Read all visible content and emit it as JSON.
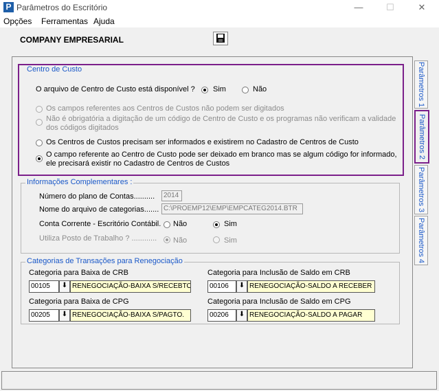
{
  "window": {
    "title": "Parâmetros do Escritório",
    "minimize": "—",
    "maximize": "☐",
    "close": "✕"
  },
  "menu": [
    "Opções",
    "Ferramentas",
    "Ajuda"
  ],
  "header": {
    "company": "COMPANY EMPRESARIAL"
  },
  "tabs": [
    "Parâmetros 1",
    "Parâmetros 2",
    "Parâmetros 3",
    "Parâmetros 4"
  ],
  "centro_custo": {
    "title": "Centro de Custo",
    "question": "O arquivo de  Centro de Custo  está disponível ?",
    "sim": "Sim",
    "nao": "Não",
    "options": [
      "Os campos referentes aos Centros de Custos não podem ser digitados",
      "Não é obrigatória a digitação de um código de Centro de Custo e os programas não verificam a validade",
      "dos códigos digitados",
      "Os Centros de Custos precisam ser informados e existirem no Cadastro de Centros de Custo",
      "O campo referente ao Centro de Custo pode ser deixado em branco mas se algum código for informado,",
      "ele precisará existir no Cadastro de Centros de Custos"
    ]
  },
  "info": {
    "title": "Informações Complementares :",
    "plano_label": "Número do plano de Contas..........",
    "plano_value": "2014",
    "arquivo_label": "Nome do arquivo de categorias.......",
    "arquivo_value": "C:\\PROEMP12\\EMP\\EMPCATEG2014.BTR",
    "conta_label": "Conta Corrente - Escritório Contábil.",
    "conta_nao": "Não",
    "conta_sim": "Sim",
    "posto_label": "Utiliza Posto de Trabalho ? ............",
    "posto_nao": "Não",
    "posto_sim": "Sim"
  },
  "categorias": {
    "title": "Categorias de Transações para Renegociação",
    "baixa_crb": {
      "label": "Categoria para Baixa de CRB",
      "code": "00105",
      "name": "RENEGOCIAÇÃO-BAIXA S/RECEBTO."
    },
    "incl_crb": {
      "label": "Categoria para Inclusão de Saldo em CRB",
      "code": "00106",
      "name": "RENEGOCIAÇÃO-SALDO A RECEBER"
    },
    "baixa_cpg": {
      "label": "Categoria para Baixa de CPG",
      "code": "00205",
      "name": "RENEGOCIAÇÃO-BAIXA S/PAGTO."
    },
    "incl_cpg": {
      "label": "Categoria para Inclusão de Saldo em CPG",
      "code": "00206",
      "name": "RENEGOCIAÇÃO-SALDO A PAGAR"
    },
    "dropdown_glyph": "⬇"
  },
  "colors": {
    "accent": "#1a58c8",
    "highlight": "#7b1f8a",
    "lookup_bg": "#ffffd2"
  }
}
